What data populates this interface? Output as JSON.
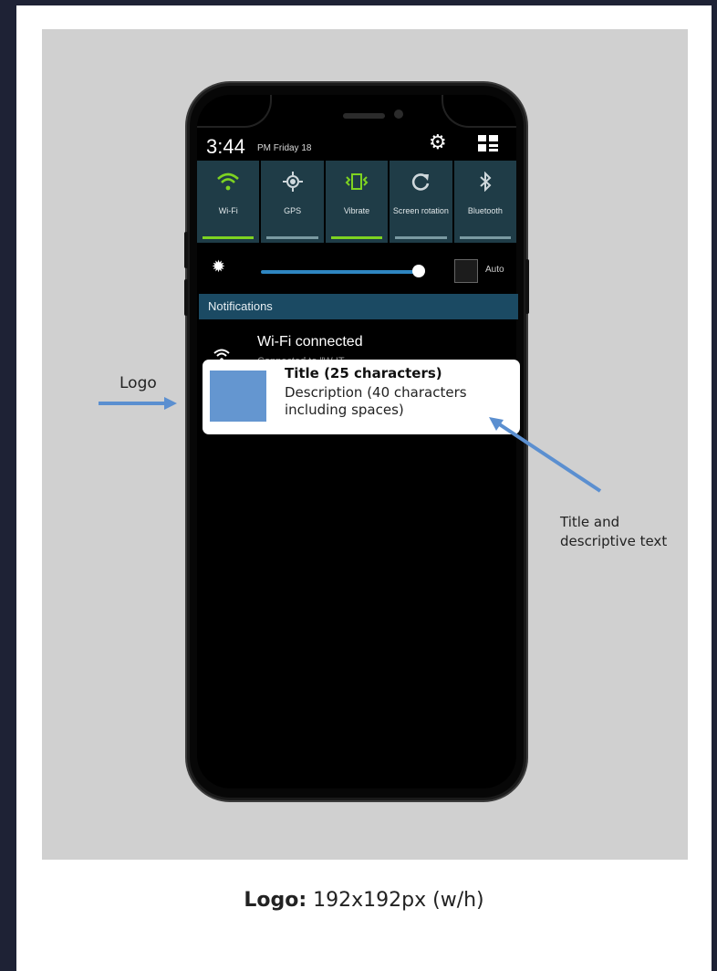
{
  "phone": {
    "status": {
      "time": "3:44",
      "ampm_date": "PM Friday 18"
    },
    "quick_settings": [
      {
        "label": "Wi-Fi",
        "icon": "wifi-icon",
        "active": true,
        "color": "#7ed321"
      },
      {
        "label": "GPS",
        "icon": "gps-icon",
        "active": false,
        "color": "#cfd8dc"
      },
      {
        "label": "Vibrate",
        "icon": "vibrate-icon",
        "active": true,
        "color": "#7ed321"
      },
      {
        "label": "Screen rotation",
        "icon": "rotation-icon",
        "active": false,
        "color": "#cfd8dc"
      },
      {
        "label": "Bluetooth",
        "icon": "bluetooth-icon",
        "active": false,
        "color": "#cfd8dc"
      }
    ],
    "brightness": {
      "auto_label": "Auto",
      "level": 0.97
    },
    "notifications_header": "Notifications",
    "wifi_notification": {
      "title": "Wi-Fi connected",
      "description": "Connected to \"W IT"
    }
  },
  "example_notification": {
    "title": "Title (25 characters)",
    "description": "Description (40 characters including spaces)"
  },
  "annotations": {
    "logo": "Logo",
    "title_text": "Title and descriptive text"
  },
  "footer": {
    "bold": "Logo:",
    "rest": " 192x192px (w/h)"
  },
  "colors": {
    "background": "#1e2235",
    "stage": "#d0d0d0",
    "accent": "#6496d0",
    "arrow": "#5b8fd0"
  }
}
